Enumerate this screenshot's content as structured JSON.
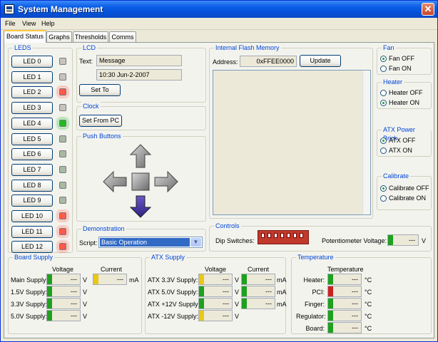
{
  "window": {
    "title": "System Management",
    "close_glyph": "✕"
  },
  "menu": [
    "File",
    "View",
    "Help"
  ],
  "tabs": [
    "Board Status",
    "Graphs",
    "Thresholds",
    "Comms"
  ],
  "leds": {
    "title": "LEDS",
    "items": [
      {
        "label": "LED 0",
        "color": "#c7c4bd"
      },
      {
        "label": "LED 1",
        "color": "#c7c4bd"
      },
      {
        "label": "LED 2",
        "color": "#ff5a4a"
      },
      {
        "label": "LED 3",
        "color": "#c7c4bd"
      },
      {
        "label": "LED 4",
        "color": "#22b822"
      },
      {
        "label": "LED 5",
        "color": "#a8baa2"
      },
      {
        "label": "LED 6",
        "color": "#a8baa2"
      },
      {
        "label": "LED 7",
        "color": "#a8baa2"
      },
      {
        "label": "LED 8",
        "color": "#a8baa2"
      },
      {
        "label": "LED 9",
        "color": "#a8baa2"
      },
      {
        "label": "LED 10",
        "color": "#ff5a4a"
      },
      {
        "label": "LED 11",
        "color": "#ff5a4a"
      },
      {
        "label": "LED 12",
        "color": "#ff5a4a"
      }
    ]
  },
  "lcd": {
    "title": "LCD",
    "text_label": "Text:",
    "line1": "Message",
    "line2": "10:30 Jun-2-2007",
    "set_button": "Set To"
  },
  "clock": {
    "title": "Clock",
    "button": "Set From PC"
  },
  "push_buttons": {
    "title": "Push Buttons"
  },
  "demonstration": {
    "title": "Demonstration",
    "script_label": "Script:",
    "script_value": "Basic Operation"
  },
  "flash": {
    "title": "Internal Flash Memory",
    "address_label": "Address:",
    "address_value": "0xFFEE0000",
    "update_button": "Update"
  },
  "fan": {
    "title": "Fan",
    "options": [
      "Fan OFF",
      "Fan ON"
    ],
    "selected": 0
  },
  "heater": {
    "title": "Heater",
    "options": [
      "Heater OFF",
      "Heater ON"
    ],
    "selected": 1
  },
  "atx_brick": {
    "title": "ATX Power Brick",
    "options": [
      "ATX OFF",
      "ATX ON"
    ],
    "selected": 0
  },
  "calibrate": {
    "title": "Calibrate",
    "options": [
      "Calibrate OFF",
      "Calibrate ON"
    ],
    "selected": 0
  },
  "controls": {
    "title": "Controls",
    "dip_label": "Dip Switches:",
    "pot_label": "Potentiometer Voltage:",
    "pot_value": "---",
    "pot_unit": "V"
  },
  "board_supply": {
    "title": "Board Supply",
    "voltage_header": "Voltage",
    "current_header": "Current",
    "rows": [
      {
        "label": "Main Supply:",
        "value": "---",
        "unit": "V"
      },
      {
        "label": "1.5V Supply:",
        "value": "---",
        "unit": "V"
      },
      {
        "label": "3.3V Supply:",
        "value": "---",
        "unit": "V"
      },
      {
        "label": "5.0V Supply:",
        "value": "---",
        "unit": "V"
      }
    ],
    "current_value": "---",
    "current_unit": "mA"
  },
  "atx_supply": {
    "title": "ATX Supply",
    "voltage_header": "Voltage",
    "current_header": "Current",
    "rows": [
      {
        "label": "ATX 3.3V Supply:",
        "value": "---",
        "unit": "V",
        "current": "---",
        "cunit": "mA"
      },
      {
        "label": "ATX 5.0V Supply:",
        "value": "---",
        "unit": "V",
        "current": "---",
        "cunit": "mA"
      },
      {
        "label": "ATX +12V Supply:",
        "value": "---",
        "unit": "V",
        "current": "---",
        "cunit": "mA"
      },
      {
        "label": "ATX -12V Supply:",
        "value": "---",
        "unit": "V"
      }
    ]
  },
  "temperature": {
    "title": "Temperature",
    "header": "Temperature",
    "rows": [
      {
        "label": "Heater:",
        "value": "---",
        "unit": "°C"
      },
      {
        "label": "PCI:",
        "value": "---",
        "unit": "°C"
      },
      {
        "label": "Finger:",
        "value": "---",
        "unit": "°C"
      },
      {
        "label": "Regulator:",
        "value": "---",
        "unit": "°C"
      },
      {
        "label": "Board:",
        "value": "---",
        "unit": "°C"
      }
    ]
  },
  "colors": {
    "meter_green": "#1fa01f",
    "meter_yellow": "#e8c816",
    "meter_red": "#cc2020",
    "group_title": "#0046d5"
  }
}
